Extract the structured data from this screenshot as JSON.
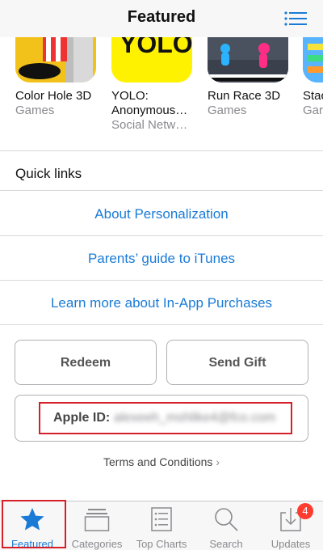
{
  "header": {
    "title": "Featured",
    "list_icon": "list-icon"
  },
  "apps": [
    {
      "name": "Color Hole 3D",
      "category": "Games"
    },
    {
      "name": "YOLO:",
      "name2": "Anonymous…",
      "category": "Social Netw…",
      "icon_text": "YOLO"
    },
    {
      "name": "Run Race 3D",
      "category": "Games"
    },
    {
      "name": "Stac",
      "category": "Gar"
    }
  ],
  "quick_links": {
    "title": "Quick links",
    "items": [
      "About Personalization",
      "Parents’ guide to iTunes",
      "Learn more about In-App Purchases"
    ]
  },
  "buttons": {
    "redeem": "Redeem",
    "send_gift": "Send Gift"
  },
  "apple_id": {
    "label": "Apple ID:",
    "value": "alexeeh_mshlike4@fco.com"
  },
  "terms": "Terms and Conditions",
  "tabs": [
    {
      "label": "Featured",
      "icon": "star-icon"
    },
    {
      "label": "Categories",
      "icon": "stack-icon"
    },
    {
      "label": "Top Charts",
      "icon": "list-icon"
    },
    {
      "label": "Search",
      "icon": "search-icon"
    },
    {
      "label": "Updates",
      "icon": "download-icon",
      "badge": "4"
    }
  ],
  "colors": {
    "accent": "#1a7bd6",
    "highlight": "#d5202a",
    "badge": "#ff3b30"
  }
}
